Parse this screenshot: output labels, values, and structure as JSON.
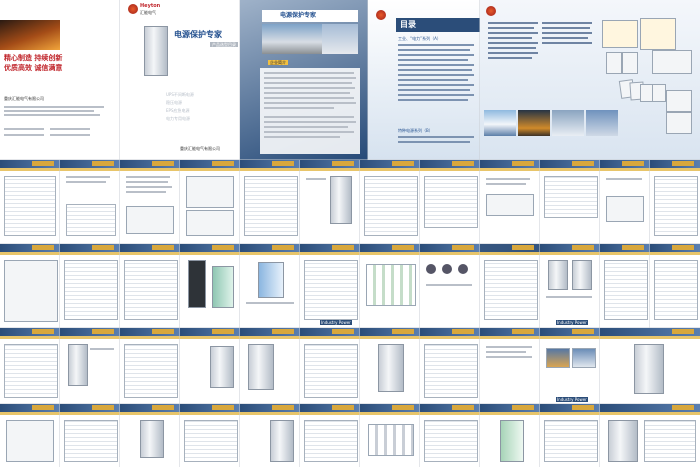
{
  "cover": {
    "brand_en": "Heyton",
    "brand_cn": "汇能电气",
    "title": "电源保护专家",
    "badge": "产品选型目录",
    "slogan_1": "精心制造  持续创新",
    "slogan_2": "优质高效  诚信满意",
    "company": "重庆汇能电气有限公司",
    "bullet_1": "UPS不间断电源",
    "bullet_2": "稳压电源",
    "bullet_3": "EPS应急电源",
    "bullet_4": "电力专用电源"
  },
  "intro": {
    "title": "电源保护专家",
    "section": "企业简介"
  },
  "toc": {
    "title": "目录",
    "section_1": "工业、“电力”系列（A）",
    "section_2": "特种电源系列（B）"
  },
  "footer_label": "Industry Power",
  "colors": {
    "band": "#2b4d79",
    "accent": "#d8a73c",
    "red": "#c0262c"
  }
}
